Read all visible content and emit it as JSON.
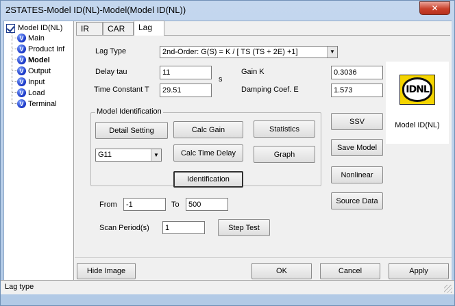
{
  "window": {
    "title": "2STATES-Model ID(NL)-Model(Model ID(NL))",
    "close_label": "✕"
  },
  "tree": {
    "root": "Model ID(NL)",
    "items": [
      {
        "label": "Main",
        "icon": "v-icon"
      },
      {
        "label": "Product Inf",
        "icon": "v-icon"
      },
      {
        "label": "Model",
        "icon": "v-icon",
        "selected": true
      },
      {
        "label": "Output",
        "icon": "v-icon"
      },
      {
        "label": "Input",
        "icon": "v-icon"
      },
      {
        "label": "Load",
        "icon": "v-icon"
      },
      {
        "label": "Terminal",
        "icon": "v-icon"
      }
    ]
  },
  "tabs": [
    {
      "label": "IR"
    },
    {
      "label": "CAR"
    },
    {
      "label": "Lag",
      "active": true
    }
  ],
  "lag": {
    "lag_type_label": "Lag Type",
    "lag_type_value": "2nd-Order: G(S) = K / [ TS (TS + 2E) +1]",
    "delay_tau_label": "Delay tau",
    "delay_tau_value": "11",
    "delay_unit": "s",
    "gain_k_label": "Gain K",
    "gain_k_value": "0.3036",
    "time_constant_label": "Time Constant T",
    "time_constant_value": "29.51",
    "damping_label": "Damping Coef. E",
    "damping_value": "1.573"
  },
  "model_identification": {
    "group_title": "Model Identification",
    "detail_setting": "Detail Setting",
    "calc_gain": "Calc Gain",
    "statistics": "Statistics",
    "selector_value": "G11",
    "calc_time_delay": "Calc Time Delay",
    "graph": "Graph",
    "identification": "Identification"
  },
  "range": {
    "from_label": "From",
    "from_value": "-1",
    "to_label": "To",
    "to_value": "500",
    "scan_period_label": "Scan Period(s)",
    "scan_period_value": "1",
    "step_test": "Step Test"
  },
  "side_buttons": {
    "ssv": "SSV",
    "save_model": "Save Model",
    "nonlinear": "Nonlinear",
    "source_data": "Source Data"
  },
  "image": {
    "logo_text": "IDNL",
    "caption": "Model ID(NL)"
  },
  "footer": {
    "hide_image": "Hide Image",
    "ok": "OK",
    "cancel": "Cancel",
    "apply": "Apply"
  },
  "status": {
    "text": "Lag type"
  }
}
